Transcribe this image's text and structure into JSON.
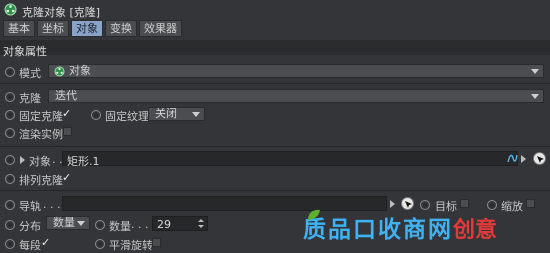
{
  "title": "克隆对象 [克隆]",
  "tabs": [
    "基本",
    "坐标",
    "对象",
    "变换",
    "效果器"
  ],
  "active_tab": "对象",
  "section": "对象属性",
  "mode": {
    "label": "模式",
    "value": "对象"
  },
  "clone": {
    "label": "克隆",
    "value": "迭代"
  },
  "fix_clone": {
    "label": "固定克隆",
    "checked": true
  },
  "fix_texture": {
    "label": "固定纹理",
    "value": "关闭"
  },
  "render_instances": {
    "label": "渲染实例",
    "checked": false
  },
  "object": {
    "label": "对象",
    "dots": ". .",
    "value": "矩形.1"
  },
  "arrange_clones": {
    "label": "排列克隆",
    "checked": true
  },
  "rail": {
    "label": "导轨",
    "dots": ". . . . . ."
  },
  "target": {
    "label": "目标",
    "checked": false
  },
  "scale": {
    "label": "缩放",
    "checked": false
  },
  "distribution": {
    "label": "分布",
    "value": "数量"
  },
  "count": {
    "label": "数量",
    "dots": ". . .",
    "value": "29"
  },
  "per_segment": {
    "label": "每段",
    "checked": true
  },
  "smooth_rotation": {
    "label": "平滑旋转",
    "checked": false
  },
  "watermark": {
    "text": "质品口收商网",
    "suffix": "创意"
  },
  "colors": {
    "active_tab": "#8aa3c8",
    "panel": "#333538",
    "section": "#2b2c2e",
    "watermark_blue": "#3fb2f2",
    "watermark_red": "#e23a3a"
  }
}
